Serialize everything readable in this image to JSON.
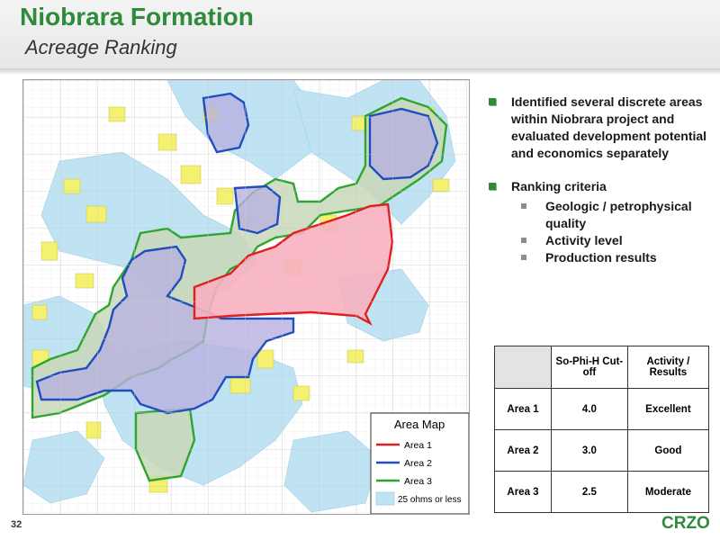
{
  "header": {
    "title": "Niobrara Formation",
    "subtitle": "Acreage Ranking"
  },
  "map": {
    "legend": {
      "title": "Area Map",
      "items": [
        {
          "label": "Area 1",
          "color": "#e02020"
        },
        {
          "label": "Area 2",
          "color": "#1f4fbf"
        },
        {
          "label": "Area 3",
          "color": "#2fa52f"
        },
        {
          "label": "25 ohms or less",
          "color": "#bfe3f2"
        }
      ]
    },
    "colors": {
      "water": "#bfe3f2",
      "acreage": "#f4f070",
      "area1_fill": "#f7b0c0",
      "area2_fill": "#b8b0e0",
      "area3_fill": "#c8d8b8"
    }
  },
  "bullets": [
    {
      "text": "Identified several discrete areas within Niobrara project and evaluated development potential and economics separately"
    },
    {
      "text": "Ranking criteria",
      "subs": [
        {
          "text": "Geologic / petrophysical quality"
        },
        {
          "text": "Activity level"
        },
        {
          "text": "Production results"
        }
      ]
    }
  ],
  "table": {
    "headers": [
      "",
      "So-Phi-H Cut-off",
      "Activity / Results"
    ],
    "rows": [
      [
        "Area 1",
        "4.0",
        "Excellent"
      ],
      [
        "Area 2",
        "3.0",
        "Good"
      ],
      [
        "Area 3",
        "2.5",
        "Moderate"
      ]
    ]
  },
  "footer": {
    "page_number": "32",
    "logo": "CRZO"
  }
}
